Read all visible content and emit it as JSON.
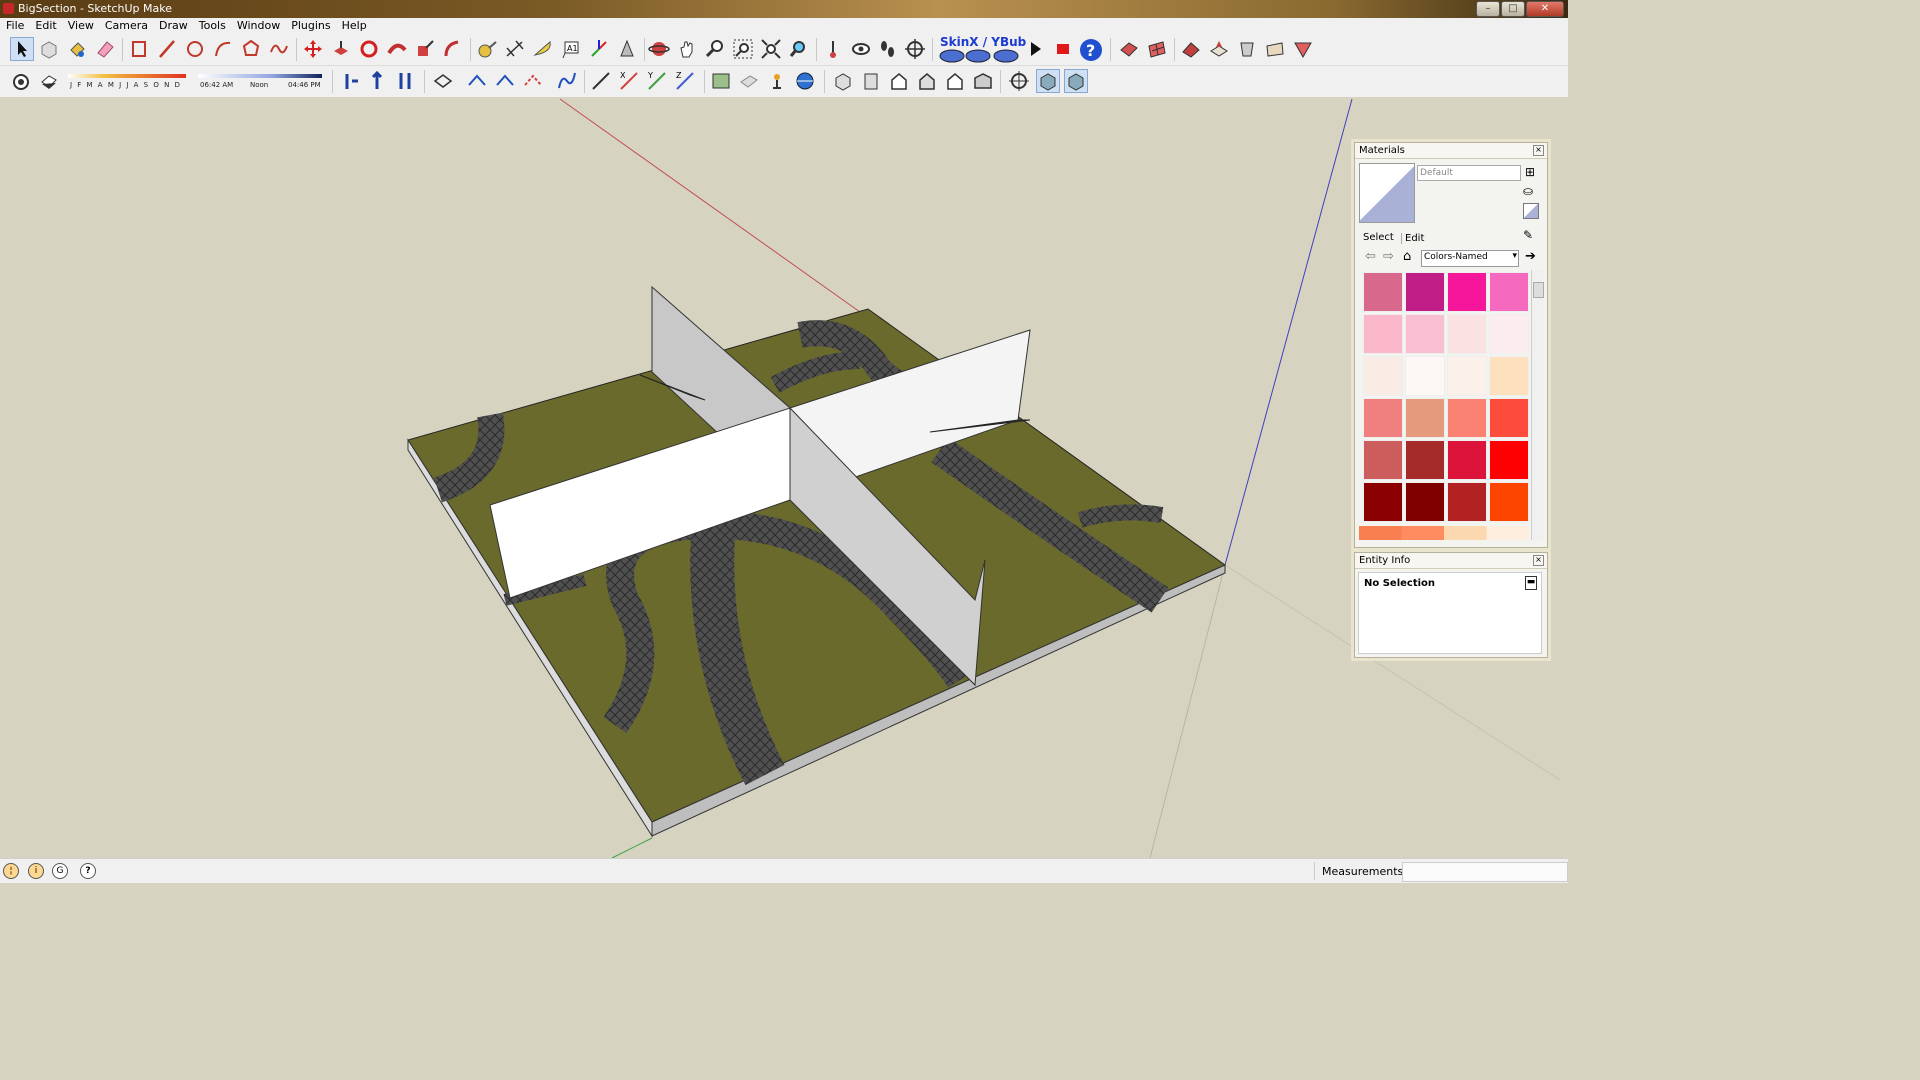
{
  "window": {
    "title": "BigSection - SketchUp Make"
  },
  "menu": [
    "File",
    "Edit",
    "View",
    "Camera",
    "Draw",
    "Tools",
    "Window",
    "Plugins",
    "Help"
  ],
  "shadow": {
    "months": "J F M A M J J A S O N D",
    "time_start": "06:42 AM",
    "time_mid": "Noon",
    "time_end": "04:46 PM"
  },
  "plugin": {
    "skinx_label": "SkinX / YBub"
  },
  "materials": {
    "title": "Materials",
    "name_value": "Default",
    "tabs": [
      "Select",
      "Edit"
    ],
    "library": "Colors-Named",
    "swatch_colors": [
      "#d9698c",
      "#c11d86",
      "#f5169c",
      "#f56abf",
      "#f9b7c9",
      "#f8bfd3",
      "#fbe2e2",
      "#fbecf0",
      "#f8ece4",
      "#fdf8f6",
      "#fcf0ea",
      "#fde0be",
      "#f08080",
      "#e59a7c",
      "#f98272",
      "#fe4c3c",
      "#cd5c5c",
      "#a52a2a",
      "#dc143c",
      "#fe0000",
      "#8b0000",
      "#800000",
      "#b22222",
      "#fe4500"
    ],
    "preview_color": "#a9b2d6"
  },
  "entity_info": {
    "title": "Entity Info",
    "status": "No Selection"
  },
  "status": {
    "measurements_label": "Measurements",
    "measurements_value": ""
  }
}
